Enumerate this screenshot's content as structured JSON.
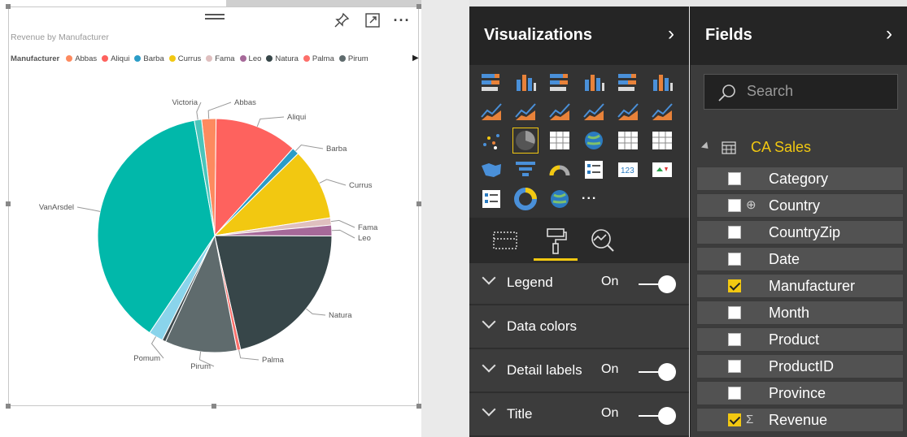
{
  "visual": {
    "title": "Revenue by Manufacturer",
    "legend_title": "Manufacturer",
    "legend_items": [
      {
        "name": "Abbas",
        "color": "#FD8A5F"
      },
      {
        "name": "Aliqui",
        "color": "#FE625E"
      },
      {
        "name": "Barba",
        "color": "#2B9CC7"
      },
      {
        "name": "Currus",
        "color": "#F2C811"
      },
      {
        "name": "Fama",
        "color": "#DFBFBF"
      },
      {
        "name": "Leo",
        "color": "#A66999"
      },
      {
        "name": "Natura",
        "color": "#374649"
      },
      {
        "name": "Palma",
        "color": "#FD6F6A"
      },
      {
        "name": "Pirum",
        "color": "#5F6B6D"
      }
    ],
    "legend_more_icon": "play-right-icon",
    "header_icons": [
      "pin-icon",
      "focus-mode-icon",
      "more-options-icon"
    ]
  },
  "chart_data": {
    "type": "pie",
    "title": "Revenue by Manufacturer",
    "legend_placement": "top-left",
    "slices": [
      {
        "label": "Abbas",
        "value": 2.0,
        "color": "#FD8A5F"
      },
      {
        "label": "Aliqui",
        "value": 11.5,
        "color": "#FE625E"
      },
      {
        "label": "Barba",
        "value": 1.0,
        "color": "#2B9CC7"
      },
      {
        "label": "Currus",
        "value": 10.0,
        "color": "#F2C811"
      },
      {
        "label": "Fama",
        "value": 1.0,
        "color": "#DFBFBF"
      },
      {
        "label": "Leo",
        "value": 1.5,
        "color": "#A66999"
      },
      {
        "label": "Natura",
        "value": 21.5,
        "color": "#374649"
      },
      {
        "label": "Palma",
        "value": 0.5,
        "color": "#FD6F6A"
      },
      {
        "label": "Pirum",
        "value": 10.0,
        "color": "#5F6B6D"
      },
      {
        "label": "Pomum",
        "value": 0.5,
        "color": "#3F4A4D"
      },
      {
        "label": "Pomum",
        "value": 2.0,
        "color": "#8AD4EB"
      },
      {
        "label": "VanArsdel",
        "value": 38.0,
        "color": "#01B8AA"
      },
      {
        "label": "Victoria",
        "value": 1.0,
        "color": "#4AC5BB"
      }
    ],
    "outer_labels": [
      "Victoria",
      "Abbas",
      "Aliqui",
      "Barba",
      "Currus",
      "Fama",
      "Leo",
      "Natura",
      "Palma",
      "Pirum",
      "Pomum",
      "VanArsdel"
    ]
  },
  "visualizations": {
    "title": "Visualizations",
    "collapse_icon": "chevron-right-icon",
    "gallery_more": "...",
    "selected": "pie-chart",
    "tabs": [
      {
        "name": "fields-tab",
        "icon": "fields-well-icon"
      },
      {
        "name": "format-tab",
        "icon": "paint-roller-icon",
        "active": true
      },
      {
        "name": "analytics-tab",
        "icon": "analytics-icon"
      }
    ],
    "sections": [
      {
        "label": "Legend",
        "state": "On",
        "toggle": true
      },
      {
        "label": "Data colors",
        "state": "",
        "toggle": false
      },
      {
        "label": "Detail labels",
        "state": "On",
        "toggle": true
      },
      {
        "label": "Title",
        "state": "On",
        "toggle": true
      }
    ]
  },
  "fields": {
    "title": "Fields",
    "collapse_icon": "chevron-right-icon",
    "search_placeholder": "Search",
    "table_name": "CA Sales",
    "items": [
      {
        "name": "Category",
        "checked": false,
        "icon": ""
      },
      {
        "name": "Country",
        "checked": false,
        "icon": "globe-icon"
      },
      {
        "name": "CountryZip",
        "checked": false,
        "icon": ""
      },
      {
        "name": "Date",
        "checked": false,
        "icon": ""
      },
      {
        "name": "Manufacturer",
        "checked": true,
        "icon": ""
      },
      {
        "name": "Month",
        "checked": false,
        "icon": ""
      },
      {
        "name": "Product",
        "checked": false,
        "icon": ""
      },
      {
        "name": "ProductID",
        "checked": false,
        "icon": ""
      },
      {
        "name": "Province",
        "checked": false,
        "icon": ""
      },
      {
        "name": "Revenue",
        "checked": true,
        "icon": "sigma-icon"
      }
    ]
  }
}
